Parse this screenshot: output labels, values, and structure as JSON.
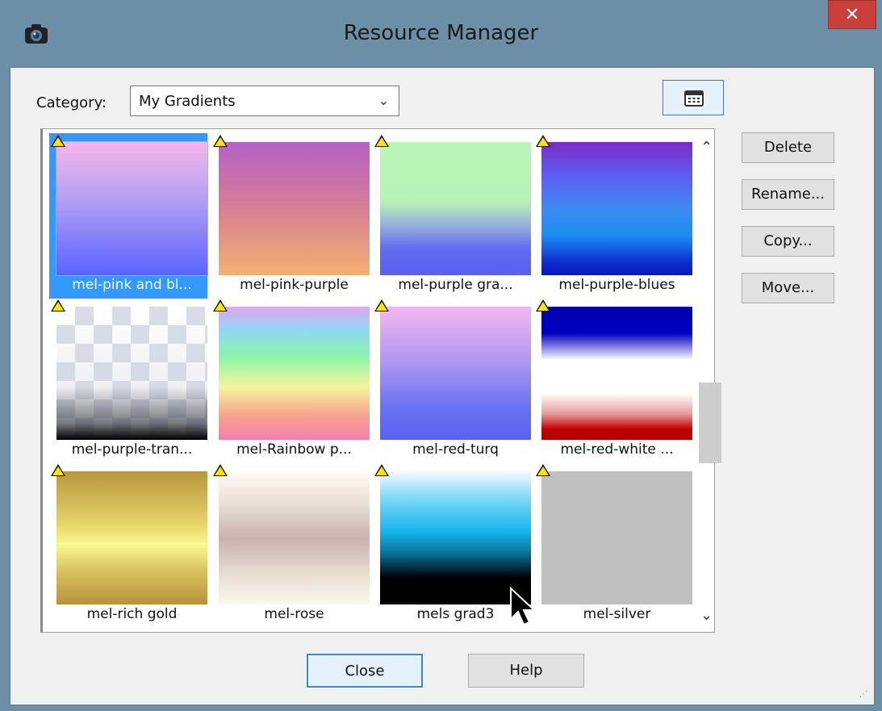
{
  "window": {
    "title": "Resource Manager",
    "close_label": "✕"
  },
  "category": {
    "label": "Category:",
    "value": "My Gradients"
  },
  "gradients": [
    {
      "label": "mel-pink and bl..."
    },
    {
      "label": "mel-pink-purple"
    },
    {
      "label": "mel-purple gra..."
    },
    {
      "label": "mel-purple-blues"
    },
    {
      "label": "mel-purple-tran..."
    },
    {
      "label": "mel-Rainbow p..."
    },
    {
      "label": "mel-red-turq"
    },
    {
      "label": "mel-red-white ..."
    },
    {
      "label": "mel-rich gold"
    },
    {
      "label": "mel-rose"
    },
    {
      "label": "mels grad3"
    },
    {
      "label": "mel-silver"
    }
  ],
  "actions": {
    "delete": "Delete",
    "rename": "Rename...",
    "copy": "Copy...",
    "move": "Move..."
  },
  "footer": {
    "close": "Close",
    "help": "Help"
  }
}
